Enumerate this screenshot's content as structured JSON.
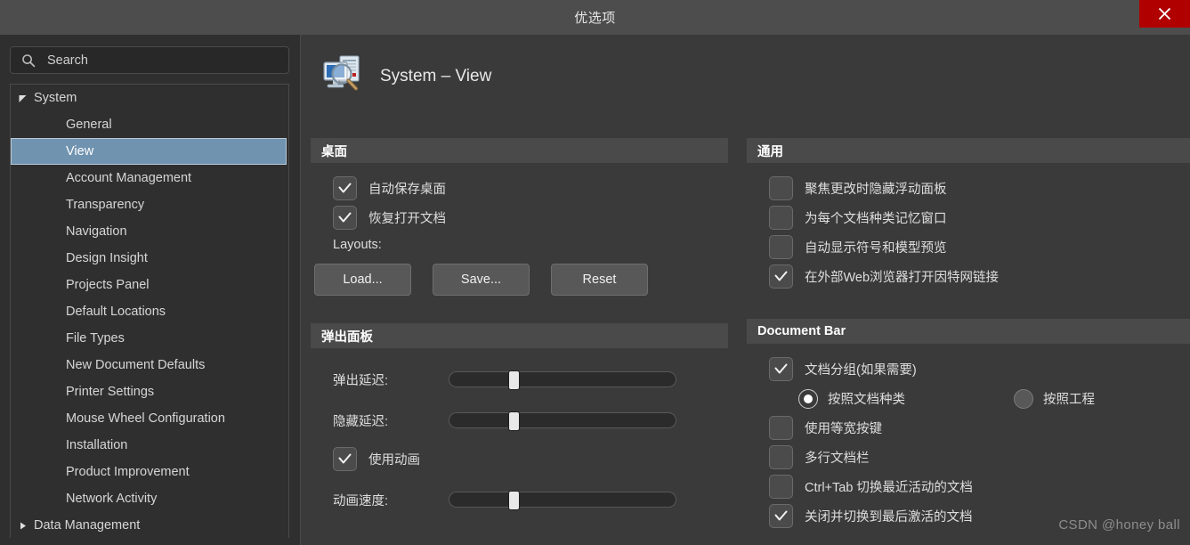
{
  "window": {
    "title": "优选项",
    "close_icon": "close-icon"
  },
  "sidebar": {
    "search": {
      "placeholder": "Search",
      "value": "Search",
      "icon": "search-icon"
    },
    "tree": [
      {
        "label": "System",
        "level": "group",
        "expanded": true,
        "selected": false
      },
      {
        "label": "General",
        "level": "child",
        "selected": false
      },
      {
        "label": "View",
        "level": "child",
        "selected": true
      },
      {
        "label": "Account Management",
        "level": "child",
        "selected": false
      },
      {
        "label": "Transparency",
        "level": "child",
        "selected": false
      },
      {
        "label": "Navigation",
        "level": "child",
        "selected": false
      },
      {
        "label": "Design Insight",
        "level": "child",
        "selected": false
      },
      {
        "label": "Projects Panel",
        "level": "child",
        "selected": false
      },
      {
        "label": "Default Locations",
        "level": "child",
        "selected": false
      },
      {
        "label": "File Types",
        "level": "child",
        "selected": false
      },
      {
        "label": "New Document Defaults",
        "level": "child",
        "selected": false
      },
      {
        "label": "Printer Settings",
        "level": "child",
        "selected": false
      },
      {
        "label": "Mouse Wheel Configuration",
        "level": "child",
        "selected": false
      },
      {
        "label": "Installation",
        "level": "child",
        "selected": false
      },
      {
        "label": "Product Improvement",
        "level": "child",
        "selected": false
      },
      {
        "label": "Network Activity",
        "level": "child",
        "selected": false
      },
      {
        "label": "Data Management",
        "level": "group",
        "expanded": false,
        "selected": false
      }
    ]
  },
  "page": {
    "icon": "system-view-icon",
    "title": "System – View"
  },
  "desktop": {
    "header": "桌面",
    "auto_save": {
      "label": "自动保存桌面",
      "checked": true
    },
    "restore_docs": {
      "label": "恢复打开文档",
      "checked": true
    },
    "layouts_label": "Layouts:",
    "buttons": [
      {
        "label": "Load..."
      },
      {
        "label": "Save..."
      },
      {
        "label": "Reset"
      }
    ]
  },
  "popup_panel": {
    "header": "弹出面板",
    "popup_delay": {
      "label": "弹出延迟:",
      "value": 26
    },
    "hide_delay": {
      "label": "隐藏延迟:",
      "value": 26
    },
    "use_animation": {
      "label": "使用动画",
      "checked": true
    },
    "animation_speed": {
      "label": "动画速度:",
      "value": 26
    }
  },
  "general": {
    "header": "通用",
    "items": [
      {
        "label": "聚焦更改时隐藏浮动面板",
        "checked": false
      },
      {
        "label": "为每个文档种类记忆窗口",
        "checked": false
      },
      {
        "label": "自动显示符号和模型预览",
        "checked": false
      },
      {
        "label": "在外部Web浏览器打开因特网链接",
        "checked": true
      }
    ]
  },
  "document_bar": {
    "header": "Document Bar",
    "group_docs": {
      "label": "文档分组(如果需要)",
      "checked": true
    },
    "radios": [
      {
        "label": "按照文档种类",
        "selected": true
      },
      {
        "label": "按照工程",
        "selected": false
      }
    ],
    "items": [
      {
        "label": "使用等宽按键",
        "checked": false
      },
      {
        "label": "多行文档栏",
        "checked": false
      },
      {
        "label": "Ctrl+Tab 切换最近活动的文档",
        "checked": false
      },
      {
        "label": "关闭并切换到最后激活的文档",
        "checked": true
      }
    ]
  },
  "watermark": "CSDN @honey ball",
  "colors": {
    "window_bg": "#2f2f2f",
    "content_bg": "#3a3a3a",
    "titlebar_bg": "#4d4d4d",
    "close_red": "#b00000",
    "selection_blue": "#7093b0",
    "group_head_bg": "#4a4a4a",
    "text": "#dedede"
  }
}
